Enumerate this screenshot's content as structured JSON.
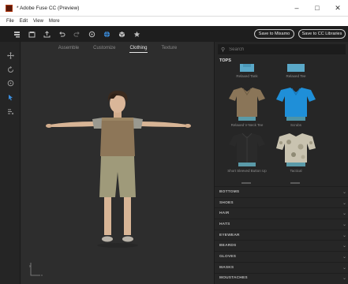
{
  "window": {
    "title": "* Adobe Fuse CC (Preview)",
    "minimize": "–",
    "maximize": "□",
    "close": "✕"
  },
  "menu": [
    "File",
    "Edit",
    "View",
    "More"
  ],
  "toolbar": {
    "save_mixamo": "Save to Mixamo",
    "save_cc": "Save to CC Libraries"
  },
  "tabs": [
    {
      "label": "Assemble",
      "active": false
    },
    {
      "label": "Customize",
      "active": false
    },
    {
      "label": "Clothing",
      "active": true
    },
    {
      "label": "Texture",
      "active": false
    }
  ],
  "axis": {
    "y": "y",
    "x": "x"
  },
  "search": {
    "placeholder": "Search"
  },
  "tops": {
    "header": "TOPS",
    "items": [
      {
        "label": "Relaxed Tank",
        "color": "#5aa8c8"
      },
      {
        "label": "Relaxed Tee",
        "color": "#5aa8c8"
      },
      {
        "label": "Relaxed V-Neck Tee",
        "color": "#8a7558"
      },
      {
        "label": "Scrubs",
        "color": "#1f8fd8"
      },
      {
        "label": "Short Sleeved Button Up",
        "color": "#2a2a2a"
      },
      {
        "label": "Tactical",
        "color": "#c9c3b0"
      }
    ]
  },
  "categories": [
    "BOTTOMS",
    "SHOES",
    "HAIR",
    "HATS",
    "EYEWEAR",
    "BEARDS",
    "GLOVES",
    "MASKS",
    "MOUSTACHES"
  ]
}
